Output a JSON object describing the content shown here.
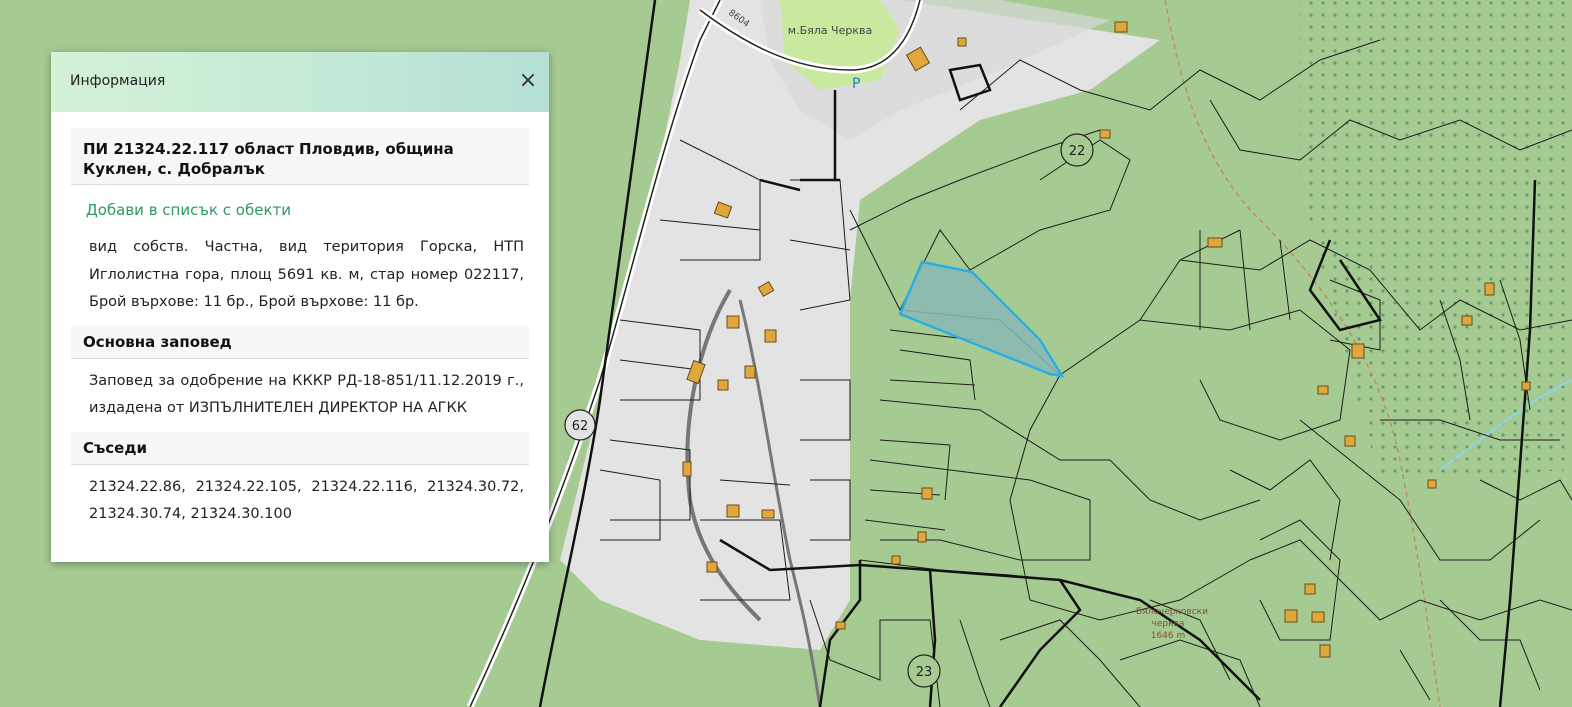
{
  "map": {
    "colors": {
      "forest": "#a6cb92",
      "settlement": "#e6e6e6",
      "selected_fill": "#8ab9b5",
      "selected_stroke": "#29aee6",
      "building": "#e0a73c",
      "road": "#ffffff"
    },
    "labels": {
      "church": "м.Бяла Черква",
      "road_number": "8604",
      "parcel_22": "22",
      "parcel_23": "23",
      "parcel_62": "62",
      "chapel_line1": "Бялочерковски",
      "chapel_line2": "черква",
      "chapel_line3": "1646 m",
      "parking": "P"
    }
  },
  "panel": {
    "header_title": "Информация",
    "close_symbol": "×",
    "parcel_title": "ПИ 21324.22.117 област Пловдив, община Куклен, с. Добралък",
    "add_to_list": "Добави в списък с обекти",
    "details": "вид собств. Частна, вид територия Горска, НТП Иглолистна гора, площ 5691 кв. м, стар номер 022117, Брой върхове: 11 бр., Брой върхове: 11 бр.",
    "order_title": "Основна заповед",
    "order_text": "Заповед за одобрение на КККР РД-18-851/11.12.2019 г., издадена от ИЗПЪЛНИТЕЛЕН ДИРЕКТОР НА АГКК",
    "neighbors_title": "Съседи",
    "neighbors_text": "21324.22.86, 21324.22.105, 21324.22.116, 21324.30.72, 21324.30.74, 21324.30.100"
  }
}
